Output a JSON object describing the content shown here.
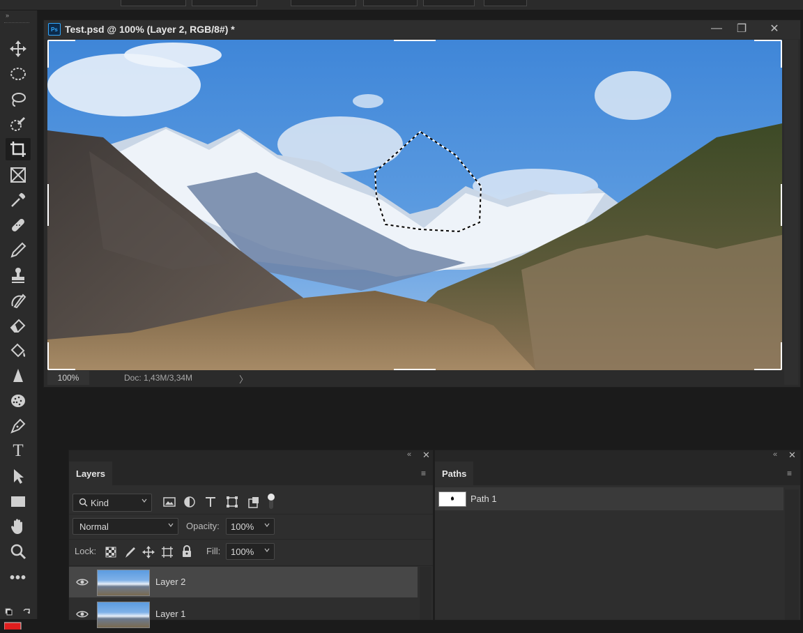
{
  "document": {
    "title": "Test.psd @ 100% (Layer 2, RGB/8#) *",
    "app_icon_label": "Ps",
    "zoom": "100%",
    "doc_info": "Doc: 1,43M/3,34M",
    "status_arrow": "〉"
  },
  "toolbar": {
    "tools": [
      {
        "name": "move-tool",
        "icon": "move-icon",
        "active": false
      },
      {
        "name": "elliptical-marquee-tool",
        "icon": "ellipse-marquee-icon",
        "active": false
      },
      {
        "name": "lasso-tool",
        "icon": "lasso-icon",
        "active": false
      },
      {
        "name": "quick-selection-tool",
        "icon": "quick-selection-icon",
        "active": false
      },
      {
        "name": "crop-tool",
        "icon": "crop-icon",
        "active": true
      },
      {
        "name": "frame-tool",
        "icon": "frame-icon",
        "active": false
      },
      {
        "name": "eyedropper-tool",
        "icon": "eyedropper-icon",
        "active": false
      },
      {
        "name": "healing-brush-tool",
        "icon": "bandage-icon",
        "active": false
      },
      {
        "name": "brush-tool",
        "icon": "brush-icon",
        "active": false
      },
      {
        "name": "clone-stamp-tool",
        "icon": "stamp-icon",
        "active": false
      },
      {
        "name": "history-brush-tool",
        "icon": "history-brush-icon",
        "active": false
      },
      {
        "name": "eraser-tool",
        "icon": "eraser-icon",
        "active": false
      },
      {
        "name": "paint-bucket-tool",
        "icon": "paint-bucket-icon",
        "active": false
      },
      {
        "name": "sharpen-tool",
        "icon": "sharpen-icon",
        "active": false
      },
      {
        "name": "sponge-tool",
        "icon": "sponge-icon",
        "active": false
      },
      {
        "name": "pen-tool",
        "icon": "pen-icon",
        "active": false
      },
      {
        "name": "type-tool",
        "icon": "type-icon",
        "active": false
      },
      {
        "name": "path-selection-tool",
        "icon": "arrow-icon",
        "active": false
      },
      {
        "name": "rectangle-tool",
        "icon": "rectangle-icon",
        "active": false
      },
      {
        "name": "hand-tool",
        "icon": "hand-icon",
        "active": false
      },
      {
        "name": "zoom-tool",
        "icon": "zoom-icon",
        "active": false
      },
      {
        "name": "more-tools",
        "icon": "more-icon",
        "active": false
      }
    ],
    "type_glyph": "T",
    "more_glyph": "•••",
    "foreground_color": "#e01e1e",
    "background_color": "#ffffff"
  },
  "layers_panel": {
    "tab_label": "Layers",
    "filter_label": "Kind",
    "blend_mode": "Normal",
    "opacity_label": "Opacity:",
    "opacity_value": "100%",
    "lock_label": "Lock:",
    "fill_label": "Fill:",
    "fill_value": "100%",
    "layers": [
      {
        "name": "Layer 2",
        "selected": true
      },
      {
        "name": "Layer 1",
        "selected": false
      }
    ]
  },
  "paths_panel": {
    "tab_label": "Paths",
    "paths": [
      {
        "name": "Path 1"
      }
    ]
  },
  "colors": {
    "accent": "#31a8ff",
    "panel_bg": "#2e2e2e"
  }
}
